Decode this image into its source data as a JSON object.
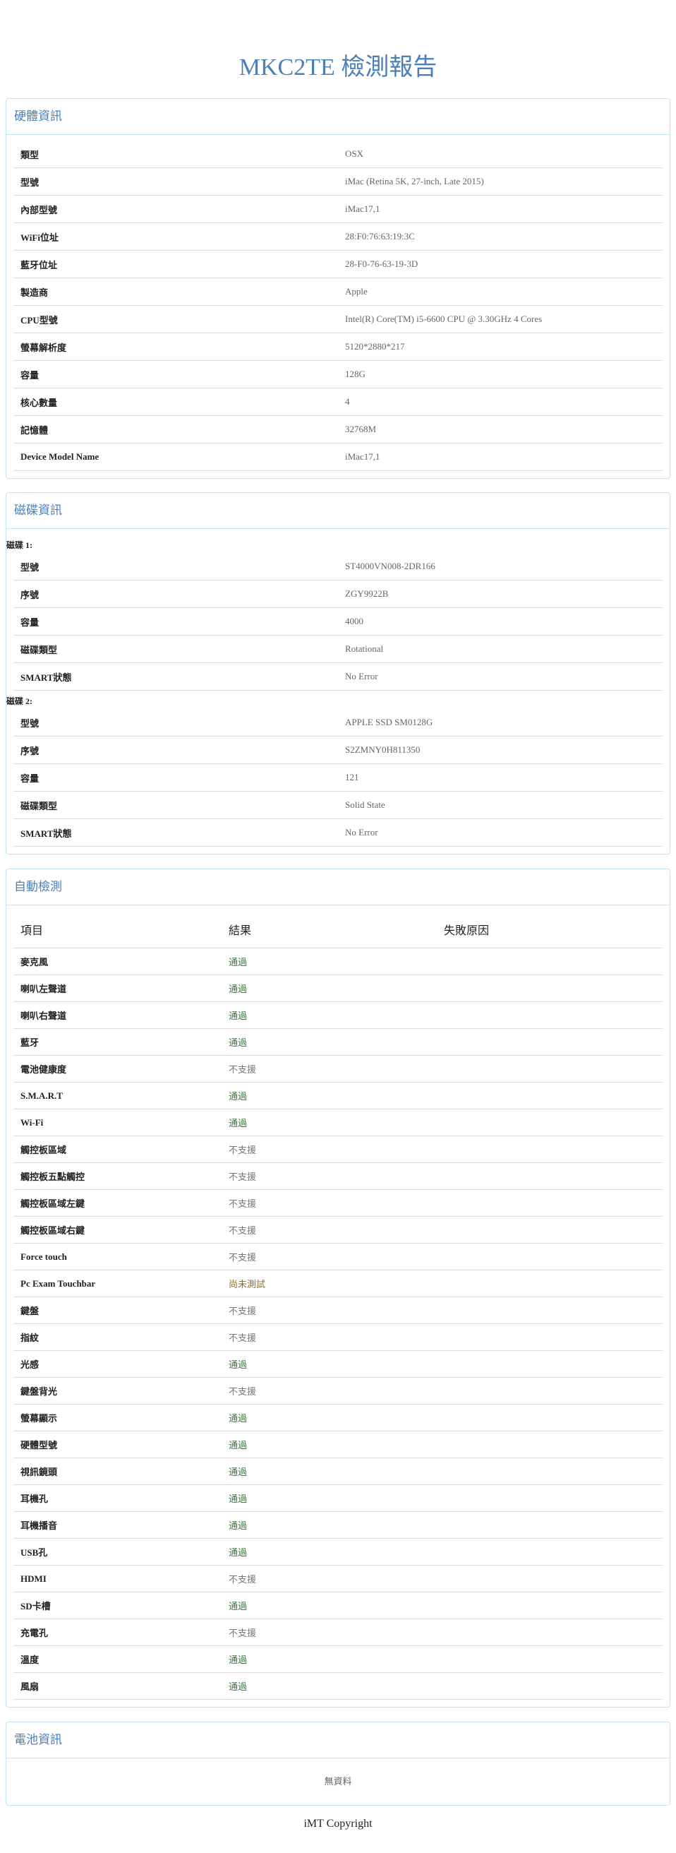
{
  "page_title": "MKC2TE 檢測報告",
  "hardware": {
    "heading": "硬體資訊",
    "rows": [
      {
        "label": "類型",
        "value": "OSX"
      },
      {
        "label": "型號",
        "value": "iMac (Retina 5K, 27-inch, Late 2015)"
      },
      {
        "label": "內部型號",
        "value": "iMac17,1"
      },
      {
        "label": "WiFi位址",
        "value": "28:F0:76:63:19:3C"
      },
      {
        "label": "藍牙位址",
        "value": "28-F0-76-63-19-3D"
      },
      {
        "label": "製造商",
        "value": "Apple"
      },
      {
        "label": "CPU型號",
        "value": "Intel(R) Core(TM) i5-6600 CPU @ 3.30GHz 4 Cores"
      },
      {
        "label": "螢幕解析度",
        "value": "5120*2880*217"
      },
      {
        "label": "容量",
        "value": "128G"
      },
      {
        "label": "核心數量",
        "value": "4"
      },
      {
        "label": "記憶體",
        "value": "32768M"
      },
      {
        "label": "Device Model Name",
        "value": "iMac17,1"
      }
    ]
  },
  "disks": {
    "heading": "磁碟資訊",
    "items": [
      {
        "title": "磁碟 1:",
        "rows": [
          {
            "label": "型號",
            "value": "ST4000VN008-2DR166"
          },
          {
            "label": "序號",
            "value": "ZGY9922B"
          },
          {
            "label": "容量",
            "value": "4000"
          },
          {
            "label": "磁碟類型",
            "value": "Rotational"
          },
          {
            "label": "SMART狀態",
            "value": "No Error"
          }
        ]
      },
      {
        "title": "磁碟 2:",
        "rows": [
          {
            "label": "型號",
            "value": "APPLE SSD SM0128G"
          },
          {
            "label": "序號",
            "value": "S2ZMNY0H811350"
          },
          {
            "label": "容量",
            "value": "121"
          },
          {
            "label": "磁碟類型",
            "value": "Solid State"
          },
          {
            "label": "SMART狀態",
            "value": "No Error"
          }
        ]
      }
    ]
  },
  "auto_test": {
    "heading": "自動檢測",
    "columns": {
      "item": "項目",
      "result": "結果",
      "reason": "失敗原因"
    },
    "rows": [
      {
        "item": "麥克風",
        "result": "通過",
        "status": "pass",
        "reason": ""
      },
      {
        "item": "喇叭左聲道",
        "result": "通過",
        "status": "pass",
        "reason": ""
      },
      {
        "item": "喇叭右聲道",
        "result": "通過",
        "status": "pass",
        "reason": ""
      },
      {
        "item": "藍牙",
        "result": "通過",
        "status": "pass",
        "reason": ""
      },
      {
        "item": "電池健康度",
        "result": "不支援",
        "status": "na",
        "reason": ""
      },
      {
        "item": "S.M.A.R.T",
        "result": "通過",
        "status": "pass",
        "reason": ""
      },
      {
        "item": "Wi-Fi",
        "result": "通過",
        "status": "pass",
        "reason": ""
      },
      {
        "item": "觸控板區域",
        "result": "不支援",
        "status": "na",
        "reason": ""
      },
      {
        "item": "觸控板五點觸控",
        "result": "不支援",
        "status": "na",
        "reason": ""
      },
      {
        "item": "觸控板區域左鍵",
        "result": "不支援",
        "status": "na",
        "reason": ""
      },
      {
        "item": "觸控板區域右鍵",
        "result": "不支援",
        "status": "na",
        "reason": ""
      },
      {
        "item": "Force touch",
        "result": "不支援",
        "status": "na",
        "reason": ""
      },
      {
        "item": "Pc Exam Touchbar",
        "result": "尚未測試",
        "status": "pending",
        "reason": ""
      },
      {
        "item": "鍵盤",
        "result": "不支援",
        "status": "na",
        "reason": ""
      },
      {
        "item": "指紋",
        "result": "不支援",
        "status": "na",
        "reason": ""
      },
      {
        "item": "光感",
        "result": "通過",
        "status": "pass",
        "reason": ""
      },
      {
        "item": "鍵盤背光",
        "result": "不支援",
        "status": "na",
        "reason": ""
      },
      {
        "item": "螢幕顯示",
        "result": "通過",
        "status": "pass",
        "reason": ""
      },
      {
        "item": "硬體型號",
        "result": "通過",
        "status": "pass",
        "reason": ""
      },
      {
        "item": "視訊鏡頭",
        "result": "通過",
        "status": "pass",
        "reason": ""
      },
      {
        "item": "耳機孔",
        "result": "通過",
        "status": "pass",
        "reason": ""
      },
      {
        "item": "耳機播音",
        "result": "通過",
        "status": "pass",
        "reason": ""
      },
      {
        "item": "USB孔",
        "result": "通過",
        "status": "pass",
        "reason": ""
      },
      {
        "item": "HDMI",
        "result": "不支援",
        "status": "na",
        "reason": ""
      },
      {
        "item": "SD卡槽",
        "result": "通過",
        "status": "pass",
        "reason": ""
      },
      {
        "item": "充電孔",
        "result": "不支援",
        "status": "na",
        "reason": ""
      },
      {
        "item": "溫度",
        "result": "通過",
        "status": "pass",
        "reason": ""
      },
      {
        "item": "風扇",
        "result": "通過",
        "status": "pass",
        "reason": ""
      }
    ]
  },
  "battery": {
    "heading": "電池資訊",
    "empty_text": "無資料"
  },
  "footer": {
    "text": "iMT Copyright"
  },
  "colors": {
    "title": "#4a7fb8",
    "panel_border": "#bce8f1",
    "pass": "#3c763d",
    "not_supported": "#777777",
    "pending": "#8a6d3b"
  }
}
